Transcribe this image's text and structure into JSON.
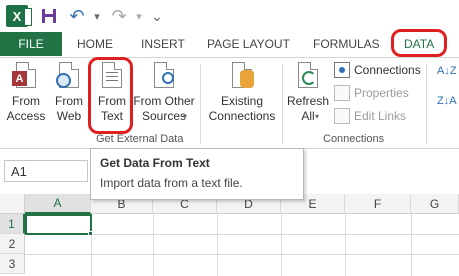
{
  "app": {
    "logo_letter": "X"
  },
  "quick_access": {
    "undo_glyph": "↶",
    "redo_glyph": "↷",
    "more_glyph": "⌄"
  },
  "tabs": [
    {
      "label": "FILE"
    },
    {
      "label": "HOME"
    },
    {
      "label": "INSERT"
    },
    {
      "label": "PAGE LAYOUT"
    },
    {
      "label": "FORMULAS"
    },
    {
      "label": "DATA"
    }
  ],
  "ribbon": {
    "get_external_data": {
      "group_label": "Get External Data",
      "from_access": "From\nAccess",
      "from_web": "From\nWeb",
      "from_text": "From\nText",
      "from_other_sources": "From Other\nSources",
      "existing_connections": "Existing\nConnections"
    },
    "connections": {
      "group_label": "Connections",
      "refresh_all": "Refresh\nAll",
      "connections": "Connections",
      "properties": "Properties",
      "edit_links": "Edit Links"
    },
    "sort": {
      "az": "A↓Z"
    }
  },
  "formula_bar": {
    "name_box": "A1"
  },
  "sheet": {
    "columns": [
      "A",
      "B",
      "C",
      "D",
      "E",
      "F",
      "G"
    ],
    "rows": [
      "1",
      "2",
      "3"
    ]
  },
  "tooltip": {
    "title": "Get Data From Text",
    "description": "Import data from a text file."
  },
  "colors": {
    "excel_green": "#217346",
    "highlight_red": "#e02020"
  }
}
